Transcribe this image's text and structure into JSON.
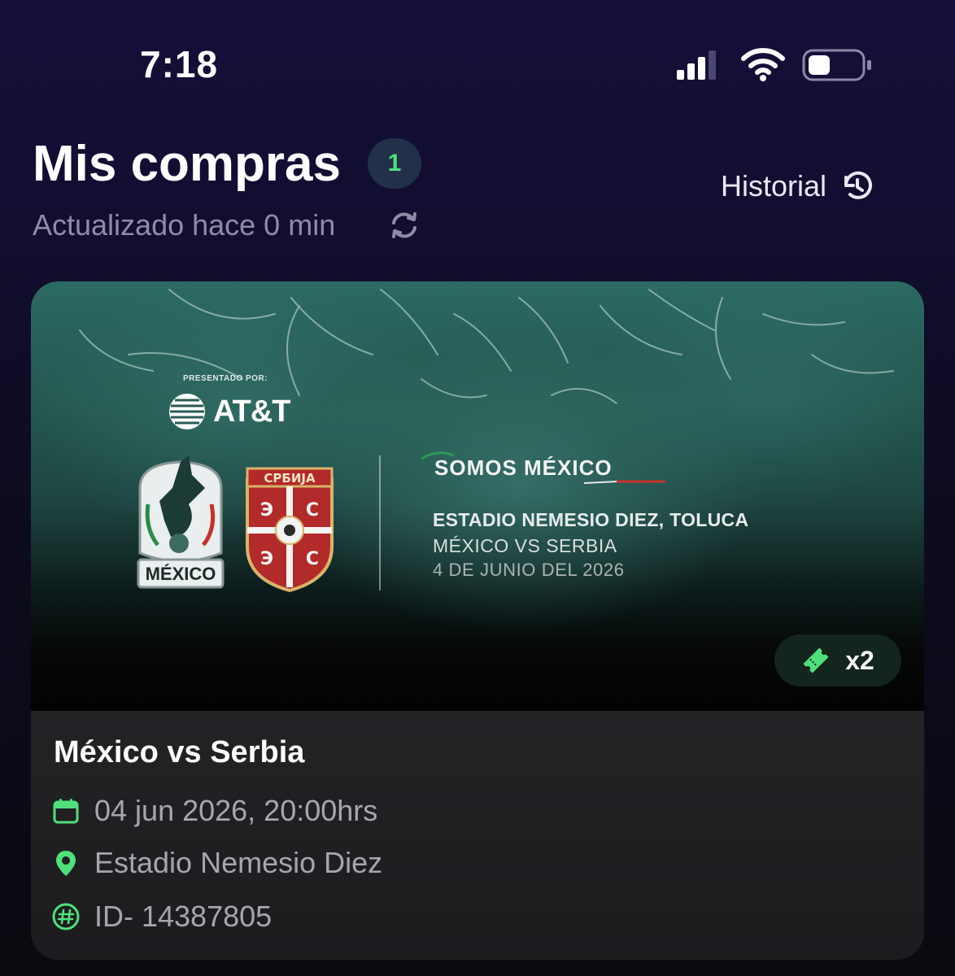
{
  "status_bar": {
    "time": "7:18"
  },
  "header": {
    "title": "Mis compras",
    "count": "1",
    "updated": "Actualizado hace 0 min",
    "history_label": "Historial"
  },
  "colors": {
    "accent_green": "#4ee07a",
    "background_top": "#150f3a",
    "card_body": "#232326"
  },
  "purchase": {
    "banner": {
      "presented_by": "PRESENTADO POR:",
      "sponsor": "AT&T",
      "serbia_crest_text": "СРБИЈА",
      "mexico_crest_text": "MÉXICO",
      "tagline": "SOMOS MÉXICO",
      "venue": "ESTADIO NEMESIO DIEZ, TOLUCA",
      "match": "MÉXICO VS SERBIA",
      "date": "4 DE JUNIO DEL 2026"
    },
    "ticket_count": "x2",
    "title": "México vs Serbia",
    "datetime": "04 jun 2026, 20:00hrs",
    "venue": "Estadio Nemesio Diez",
    "id": "ID- 14387805",
    "icons": [
      "calendar-icon",
      "location-pin-icon",
      "hash-icon",
      "ticket-icon"
    ]
  }
}
